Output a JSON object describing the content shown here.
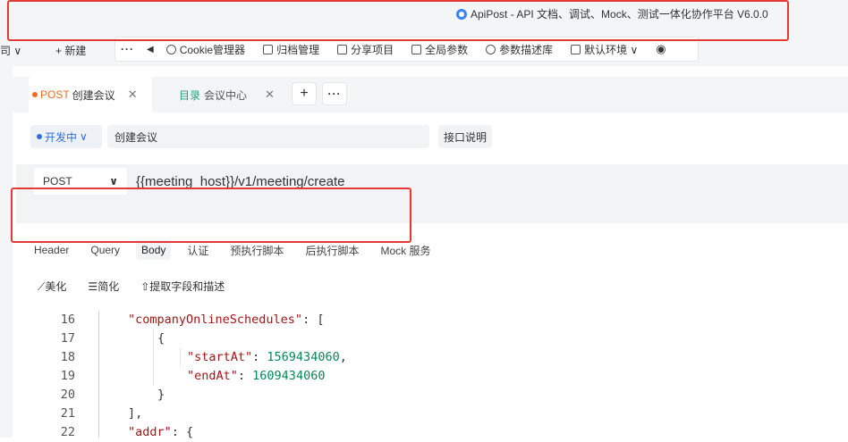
{
  "titlebar": {
    "title": "ApiPost - API 文档、调试、Mock、测试一体化协作平台 V6.0.0"
  },
  "toolbar": {
    "left_truncated": "司 ∨",
    "new_label": "+ 新建",
    "more": "···",
    "back": "◀",
    "items": [
      "Cookie管理器",
      "归档管理",
      "分享项目",
      "全局参数",
      "参数描述库",
      "默认环境 ∨"
    ]
  },
  "tabs": {
    "active": {
      "method": "POST",
      "name": "创建会议",
      "close": "✕"
    },
    "inactive": {
      "prefix": "目录",
      "name": "会议中心",
      "close": "✕"
    },
    "add": "+",
    "more": "···"
  },
  "request": {
    "status": "开发中",
    "status_arrow": "∨",
    "name_value": "创建会议",
    "desc_button": "接口说明",
    "method": "POST",
    "method_arrow": "∨",
    "url": "{{meeting_host}}/v1/meeting/create"
  },
  "req_tabs": [
    "Header",
    "Query",
    "Body",
    "认证",
    "预执行脚本",
    "后执行脚本",
    "Mock 服务"
  ],
  "body_tools": [
    "美化",
    "简化",
    "提取字段和描述"
  ],
  "code": {
    "line_numbers": [
      "16",
      "17",
      "18",
      "19",
      "20",
      "21",
      "22"
    ],
    "l16_key": "\"companyOnlineSchedules\"",
    "l16_rest": ": [",
    "l17": "{",
    "l18_key": "\"startAt\"",
    "l18_val": "1569434060",
    "l19_key": "\"endAt\"",
    "l19_val": "1609434060",
    "l20": "}",
    "l21": "],",
    "l22_key": "\"addr\"",
    "l22_rest": ": {"
  },
  "colors": {
    "accent_blue": "#2f6fde",
    "post_orange": "#f26b21",
    "dir_green": "#1aa37a",
    "highlight_red": "#e53935"
  }
}
